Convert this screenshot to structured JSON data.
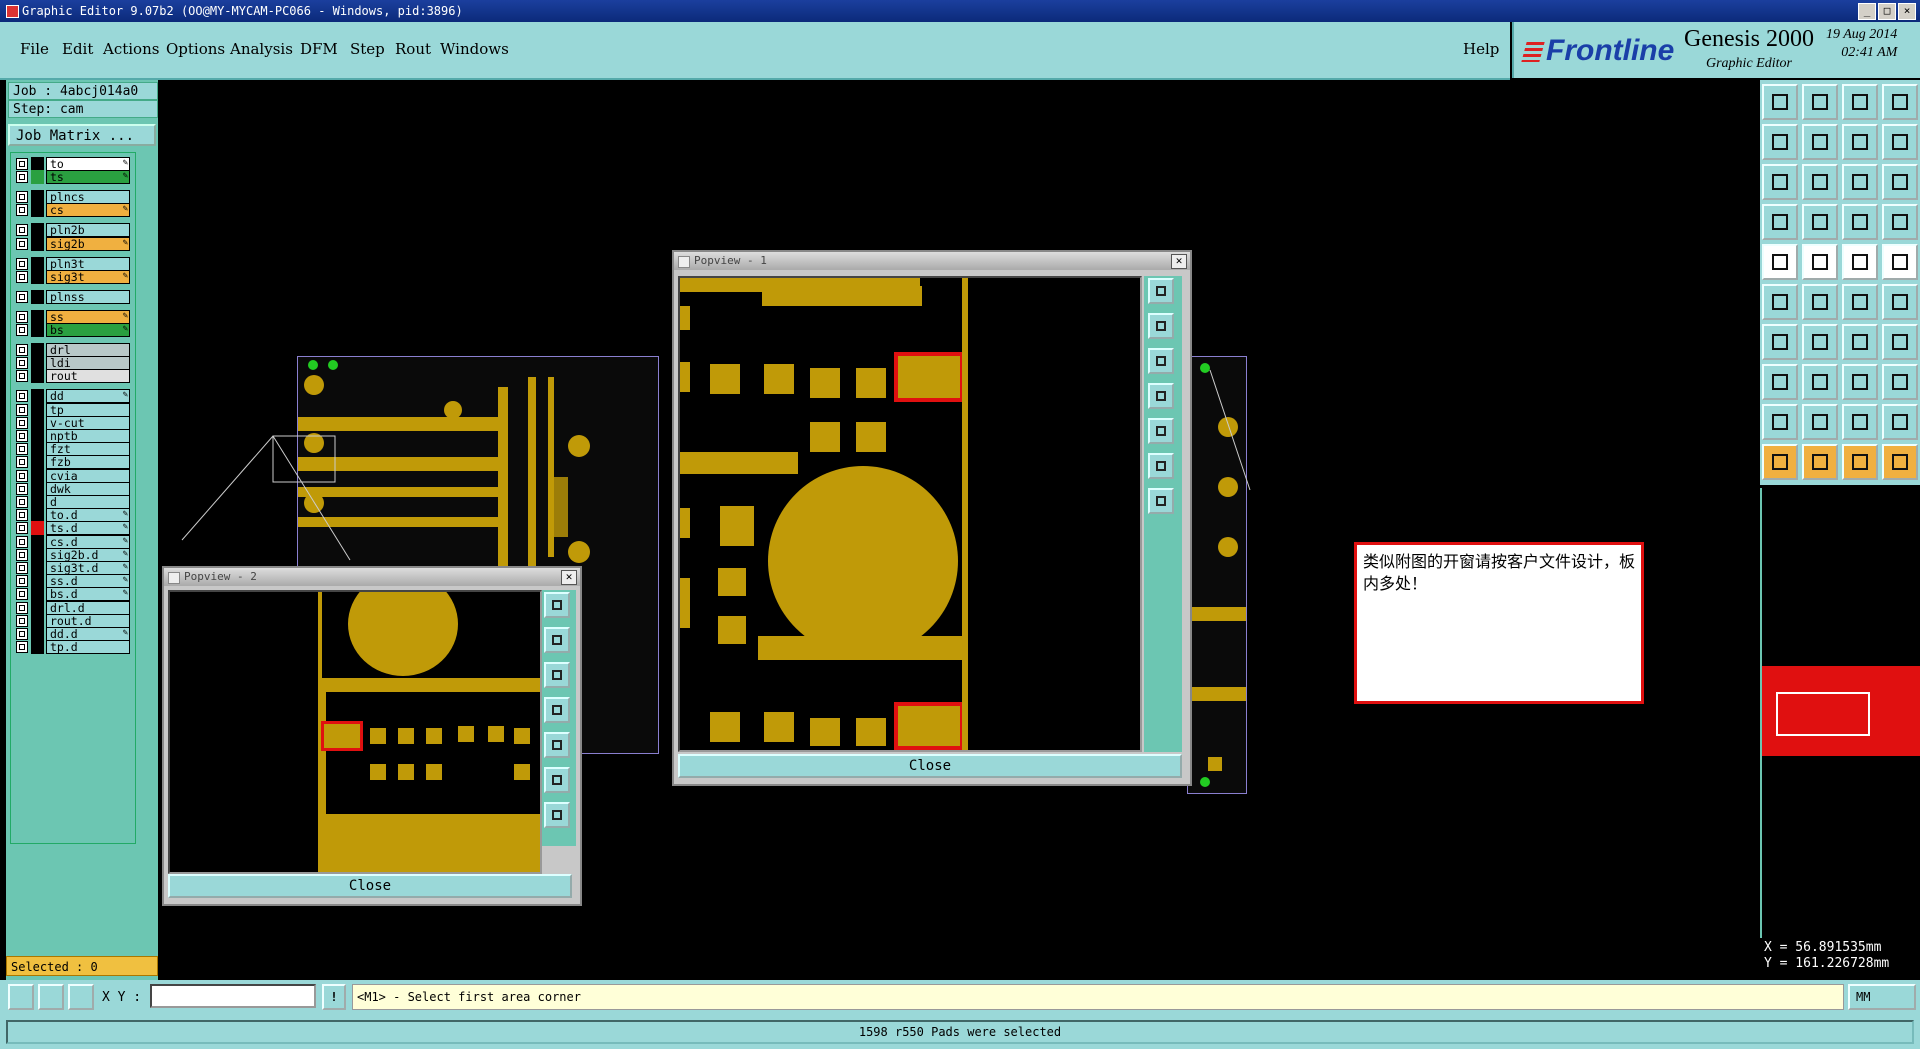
{
  "window": {
    "title": "Graphic Editor 9.07b2 (OO@MY-MYCAM-PC066 - Windows, pid:3896)"
  },
  "menu": {
    "items": [
      "File",
      "Edit",
      "Actions",
      "Options",
      "Analysis",
      "DFM",
      "Step",
      "Rout",
      "Windows"
    ],
    "help": "Help"
  },
  "brand": {
    "logo": "Frontline",
    "product": "Genesis 2000",
    "subtitle": "Graphic Editor",
    "date": "19 Aug 2014",
    "time": "02:41 AM"
  },
  "job": {
    "job_line": "Job : 4abcj014a0",
    "step_line": "Step: cam",
    "matrix_button": "Job Matrix ..."
  },
  "layers": [
    {
      "name": "to",
      "color": "#ffffff",
      "swatch": "#000000",
      "editable": true
    },
    {
      "name": "ts",
      "color": "#2aa040",
      "swatch": "#2aa040",
      "editable": true
    },
    {
      "name": "plncs",
      "color": "#9ad8d8",
      "swatch": "#000000",
      "editable": false
    },
    {
      "name": "cs",
      "color": "#f0b040",
      "swatch": "#000000",
      "editable": true
    },
    {
      "name": "pln2b",
      "color": "#9ad8d8",
      "swatch": "#000000",
      "editable": false
    },
    {
      "name": "sig2b",
      "color": "#f0b040",
      "swatch": "#000000",
      "editable": true
    },
    {
      "name": "pln3t",
      "color": "#9ad8d8",
      "swatch": "#000000",
      "editable": false
    },
    {
      "name": "sig3t",
      "color": "#f0b040",
      "swatch": "#000000",
      "editable": true
    },
    {
      "name": "plnss",
      "color": "#9ad8d8",
      "swatch": "#000000",
      "editable": false
    },
    {
      "name": "ss",
      "color": "#f0b040",
      "swatch": "#000000",
      "editable": true
    },
    {
      "name": "bs",
      "color": "#2aa040",
      "swatch": "#000000",
      "editable": true
    },
    {
      "name": "drl",
      "color": "#b8c8c8",
      "swatch": "#000000",
      "editable": false
    },
    {
      "name": "ldi",
      "color": "#b8c8c8",
      "swatch": "#000000",
      "editable": false
    },
    {
      "name": "rout",
      "color": "#e0e0e0",
      "swatch": "#000000",
      "editable": false
    },
    {
      "name": "dd",
      "color": "#9ad8d8",
      "swatch": "#000000",
      "editable": true
    },
    {
      "name": "tp",
      "color": "#9ad8d8",
      "swatch": "#000000",
      "editable": false
    },
    {
      "name": "v-cut",
      "color": "#9ad8d8",
      "swatch": "#000000",
      "editable": false
    },
    {
      "name": "nptb",
      "color": "#9ad8d8",
      "swatch": "#000000",
      "editable": false
    },
    {
      "name": "fzt",
      "color": "#9ad8d8",
      "swatch": "#000000",
      "editable": false
    },
    {
      "name": "fzb",
      "color": "#9ad8d8",
      "swatch": "#000000",
      "editable": false
    },
    {
      "name": "cvia",
      "color": "#9ad8d8",
      "swatch": "#000000",
      "editable": false
    },
    {
      "name": "dwk",
      "color": "#9ad8d8",
      "swatch": "#000000",
      "editable": false
    },
    {
      "name": "d",
      "color": "#9ad8d8",
      "swatch": "#000000",
      "editable": false
    },
    {
      "name": "to.d",
      "color": "#9ad8d8",
      "swatch": "#000000",
      "editable": true
    },
    {
      "name": "ts.d",
      "color": "#9ad8d8",
      "swatch": "#e01010",
      "editable": true
    },
    {
      "name": "cs.d",
      "color": "#9ad8d8",
      "swatch": "#000000",
      "editable": true
    },
    {
      "name": "sig2b.d",
      "color": "#9ad8d8",
      "swatch": "#000000",
      "editable": true
    },
    {
      "name": "sig3t.d",
      "color": "#9ad8d8",
      "swatch": "#000000",
      "editable": true
    },
    {
      "name": "ss.d",
      "color": "#9ad8d8",
      "swatch": "#000000",
      "editable": true
    },
    {
      "name": "bs.d",
      "color": "#9ad8d8",
      "swatch": "#000000",
      "editable": true
    },
    {
      "name": "drl.d",
      "color": "#9ad8d8",
      "swatch": "#000000",
      "editable": false
    },
    {
      "name": "rout.d",
      "color": "#9ad8d8",
      "swatch": "#000000",
      "editable": false
    },
    {
      "name": "dd.d",
      "color": "#9ad8d8",
      "swatch": "#000000",
      "editable": true
    },
    {
      "name": "tp.d",
      "color": "#9ad8d8",
      "swatch": "#000000",
      "editable": false
    }
  ],
  "selected": "Selected : 0",
  "popview1": {
    "title": "Popview - 1",
    "close": "Close"
  },
  "popview2": {
    "title": "Popview - 2",
    "close": "Close"
  },
  "note": "类似附图的开窗请按客户文件设计，板内多处！",
  "coords": {
    "x": "X = 56.891535mm",
    "y": "Y = 161.226728mm"
  },
  "bottom": {
    "xy_label": "X Y :",
    "xy_value": "",
    "excl": "!",
    "prompt": "<M1> - Select first area corner",
    "units": "MM"
  },
  "status": "1598 r550 Pads were selected"
}
